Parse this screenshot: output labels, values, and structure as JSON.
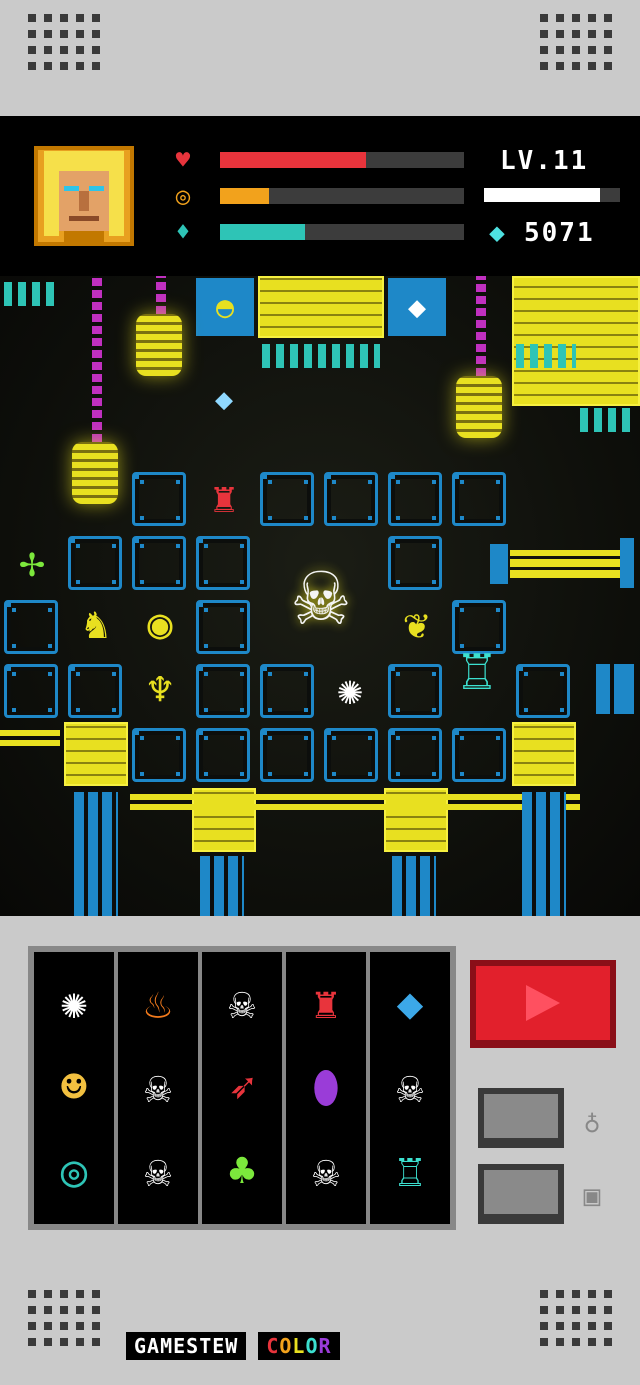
{
  "hud": {
    "level": "LV.11",
    "gems": "5071",
    "health_fraction": 0.6,
    "stamina_fraction": 0.2,
    "mana_fraction": 0.35,
    "xp_fraction": 0.85,
    "colors": {
      "health": "#e8343c",
      "stamina": "#f2a21c",
      "mana": "#2ec4b6",
      "xp": "#ffffff"
    },
    "icons": {
      "health": "heart-icon",
      "stamina": "coin-stack-icon",
      "mana": "water-drop-icon",
      "gem": "gem-icon"
    }
  },
  "hand": {
    "columns": [
      [
        "spider-web",
        "glowing-eye-ring"
      ],
      [
        "campfire",
        "skull",
        "skull"
      ],
      [
        "skull",
        "fire-spear",
        "forest-elf"
      ],
      [
        "red-hooded-mage",
        "purple-cauldron",
        "skull"
      ],
      [
        "blue-crystal",
        "skull",
        "cyan-golem"
      ]
    ],
    "column0": [
      "spider-web",
      "blond-warrior",
      "glowing-eye-ring"
    ]
  },
  "controls": {
    "play_icon": "play-icon",
    "button1_icon": "potion-icon",
    "button2_icon": "robot-face-icon"
  },
  "logo": {
    "part1": "GAMESTEW",
    "part2": "COLOR"
  },
  "colors": {
    "accent_red": "#e2202c",
    "tile_blue": "#1e88c8",
    "brick_yellow": "#e8e020"
  }
}
